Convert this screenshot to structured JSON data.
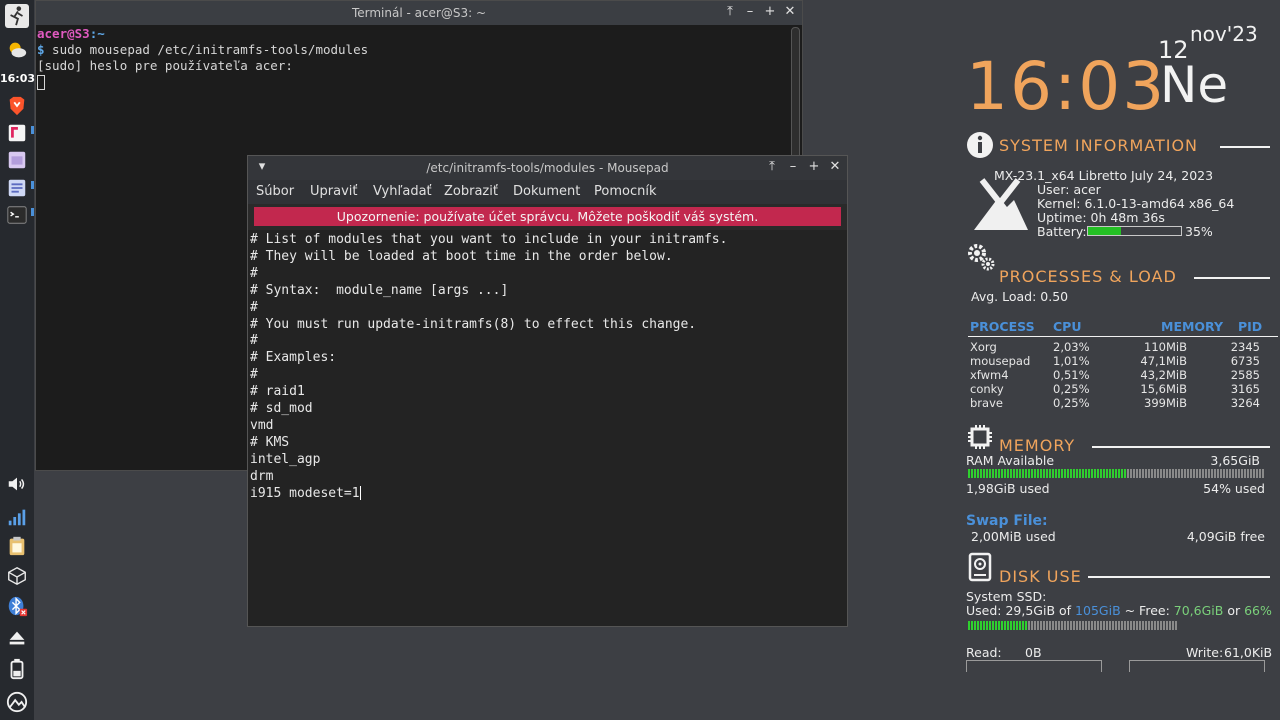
{
  "panel": {
    "clock": "16:03",
    "icons": [
      "run-icon",
      "weather-icon",
      "brave-browser-icon",
      "flameshot-icon",
      "file-manager-icon",
      "text-editor-icon",
      "terminal-icon",
      "volume-icon",
      "network-icon",
      "clipboard-icon",
      "package-icon",
      "bluetooth-icon",
      "eject-icon",
      "battery-icon",
      "mx-logo-icon"
    ]
  },
  "terminal": {
    "title": "Terminál - acer@S3: ~",
    "prompt_user": "acer@S3",
    "prompt_path": ":~",
    "prompt_symbol": "$",
    "command": " sudo mousepad /etc/initramfs-tools/modules",
    "sudo_prompt": "[sudo] heslo pre používateľa acer:"
  },
  "mousepad": {
    "title": "/etc/initramfs-tools/modules - Mousepad",
    "menu": [
      "Súbor",
      "Upraviť",
      "Vyhľadať",
      "Zobraziť",
      "Dokument",
      "Pomocník"
    ],
    "warning": "Upozornenie: používate účet správcu. Môžete poškodiť váš systém.",
    "lines": [
      "# List of modules that you want to include in your initramfs.",
      "# They will be loaded at boot time in the order below.",
      "#",
      "# Syntax:  module_name [args ...]",
      "#",
      "# You must run update-initramfs(8) to effect this change.",
      "#",
      "# Examples:",
      "#",
      "# raid1",
      "# sd_mod",
      "vmd",
      "# KMS",
      "intel_agp",
      "drm",
      "i915 modeset=1"
    ]
  },
  "conky": {
    "time": "16:03",
    "day_name": "Ne",
    "day_number": "12",
    "month_year": "nov'23",
    "system": {
      "heading": "SYSTEM INFORMATION",
      "distro": "MX-23.1_x64 Libretto July 24, 2023",
      "user": "User: acer",
      "kernel": "Kernel: 6.1.0-13-amd64 x86_64",
      "uptime": "Uptime: 0h 48m 36s",
      "battery_label": "Battery:",
      "battery_percent": "35%",
      "battery_level": 0.35
    },
    "processes": {
      "heading": "PROCESSES & LOAD",
      "avg_load": "Avg. Load: 0.50",
      "columns": [
        "PROCESS",
        "CPU",
        "MEMORY",
        "PID"
      ],
      "rows": [
        [
          "Xorg",
          "2,03%",
          "110MiB",
          "2345"
        ],
        [
          "mousepad",
          "1,01%",
          "47,1MiB",
          "6735"
        ],
        [
          "xfwm4",
          "0,51%",
          "43,2MiB",
          "2585"
        ],
        [
          "conky",
          "0,25%",
          "15,6MiB",
          "3165"
        ],
        [
          "brave",
          "0,25%",
          "399MiB",
          "3264"
        ]
      ]
    },
    "memory": {
      "heading": "MEMORY",
      "ram_label": "RAM Available",
      "ram_value": "3,65GiB",
      "used": "1,98GiB used",
      "used_percent": "54% used",
      "used_level": 0.54,
      "swap_title": "Swap File:",
      "swap_used": "2,00MiB used",
      "swap_free": "4,09GiB free"
    },
    "disk": {
      "heading": "DISK USE",
      "label": "System SSD:",
      "used_prefix": "Used: 29,5GiB of ",
      "total": "105GiB",
      "free_prefix": " ~ Free: ",
      "free": "70,6GiB",
      "or": " or ",
      "free_percent": "66%",
      "used_level": 0.28,
      "read_label": "Read:",
      "read_value": "0B",
      "write_label": "Write:",
      "write_value": "61,0KiB"
    },
    "colors": {
      "accent": "#f0a45c",
      "blue": "#4a90d9",
      "green": "#2fd02f",
      "warning": "#c2284e"
    }
  }
}
